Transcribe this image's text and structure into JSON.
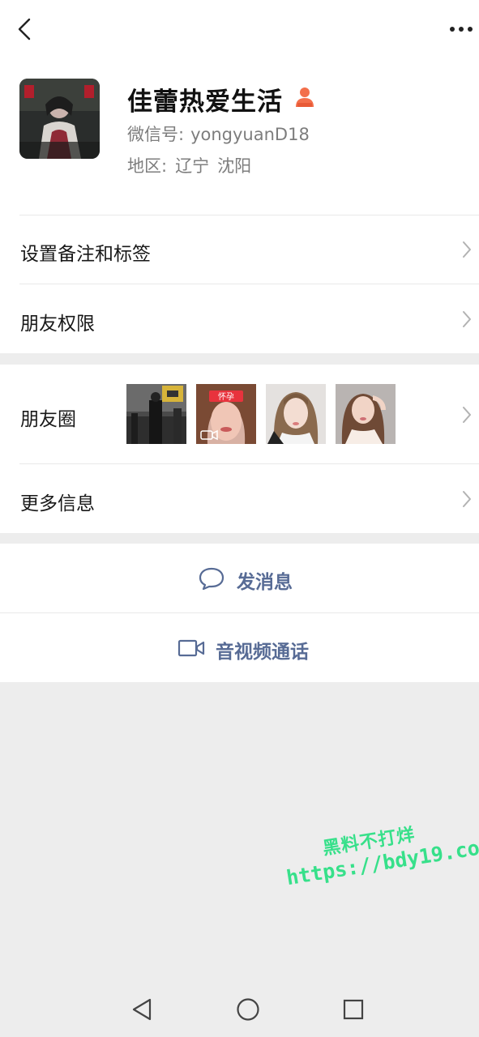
{
  "topbar": {
    "back_icon": "chevron-left-icon",
    "more_icon": "more-dots-icon"
  },
  "profile": {
    "name": "佳蕾热爱生活",
    "badge_icon": "person-badge-icon",
    "wechat_id_label": "微信号:",
    "wechat_id": "yongyuanD18",
    "region_label": "地区:",
    "region_province": "辽宁",
    "region_city": "沈阳"
  },
  "menu": {
    "remark_tags": "设置备注和标签",
    "friend_permissions": "朋友权限",
    "moments": "朋友圈",
    "more_info": "更多信息"
  },
  "moments_thumb_overlay": {
    "banner_text": "怀孕"
  },
  "actions": {
    "send_message": "发消息",
    "video_call": "音视频通话"
  },
  "watermark": {
    "line1": "黑料不打烊",
    "line2": "https://bdy19.co"
  },
  "colors": {
    "link_blue": "#576b95",
    "watermark_green": "#37e08a",
    "page_bg": "#ededed"
  }
}
